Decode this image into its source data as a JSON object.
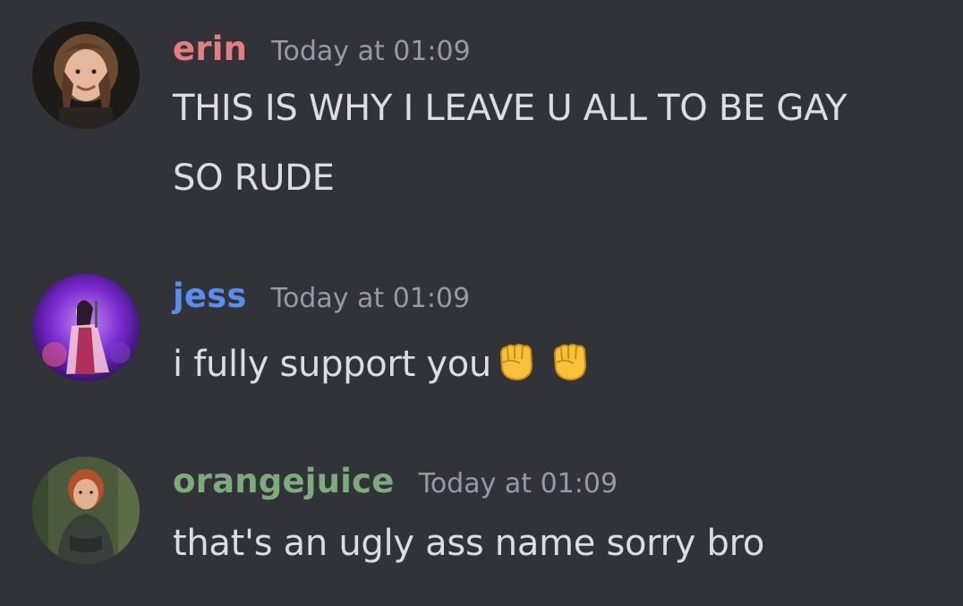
{
  "messages": [
    {
      "username": "erin",
      "username_color": "#e67e80",
      "timestamp": "Today at 01:09",
      "lines": [
        "THIS IS WHY I LEAVE U ALL TO BE GAY",
        "SO RUDE"
      ],
      "avatar_icon": "user-avatar-photo"
    },
    {
      "username": "jess",
      "username_color": "#5b8def",
      "timestamp": "Today at 01:09",
      "lines": [
        "i fully support you"
      ],
      "emoji": [
        "raised-fist-emoji",
        "raised-fist-emoji"
      ],
      "avatar_icon": "user-avatar-photo"
    },
    {
      "username": "orangejuice",
      "username_color": "#7dab7e",
      "timestamp": "Today at 01:09",
      "lines": [
        "that's an ugly ass name sorry bro"
      ],
      "avatar_icon": "user-avatar-photo"
    }
  ]
}
